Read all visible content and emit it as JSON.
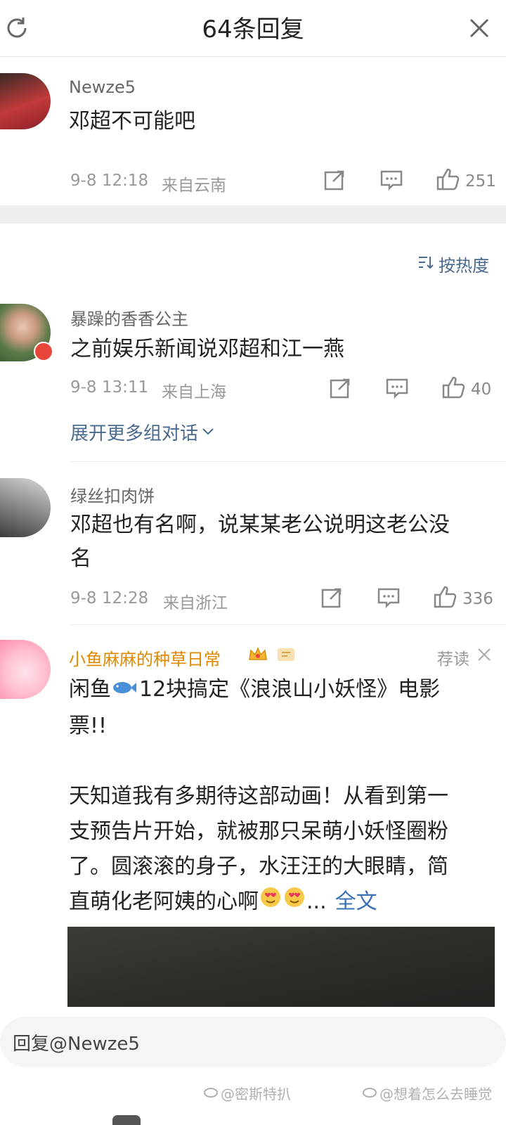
{
  "header": {
    "title": "64条回复"
  },
  "main_comment": {
    "username": "Newze5",
    "text": "邓超不可能吧",
    "time": "9-8 12:18",
    "location": "来自云南",
    "likes": "251"
  },
  "sort": {
    "label": "按热度"
  },
  "comments": [
    {
      "username": "暴躁的香香公主",
      "text": "之前娱乐新闻说邓超和江一燕",
      "time": "9-8 13:11",
      "location": "来自上海",
      "likes": "40",
      "expand": "展开更多组对话"
    },
    {
      "username": "绿丝扣肉饼",
      "text_line1": "邓超也有名啊，说某某老公说明这老公没",
      "text_line2": "名",
      "time": "9-8 12:28",
      "location": "来自浙江",
      "likes": "336"
    }
  ],
  "ad": {
    "username": "小鱼麻麻的种草日常",
    "tag": "荐读",
    "line1a": "闲鱼",
    "line1b": "12块搞定《浪浪山小妖怪》电影",
    "line2": "票!!",
    "para_lines": [
      "天知道我有多期待这部动画！从看到第一",
      "支预告片开始，就被那只呆萌小妖怪圈粉",
      "了。圆滚滚的身子，水汪汪的大眼睛，简"
    ],
    "last_line": "直萌化老阿姨的心啊",
    "ellipsis": "...",
    "full_text": "全文"
  },
  "reply_bar": {
    "placeholder": "回复@Newze5"
  },
  "watermarks": [
    "@密斯特扒",
    "@想着怎么去睡觉"
  ],
  "colors": {
    "vip": "#e08a00",
    "link": "#3a6fb5",
    "meta": "#999999"
  }
}
